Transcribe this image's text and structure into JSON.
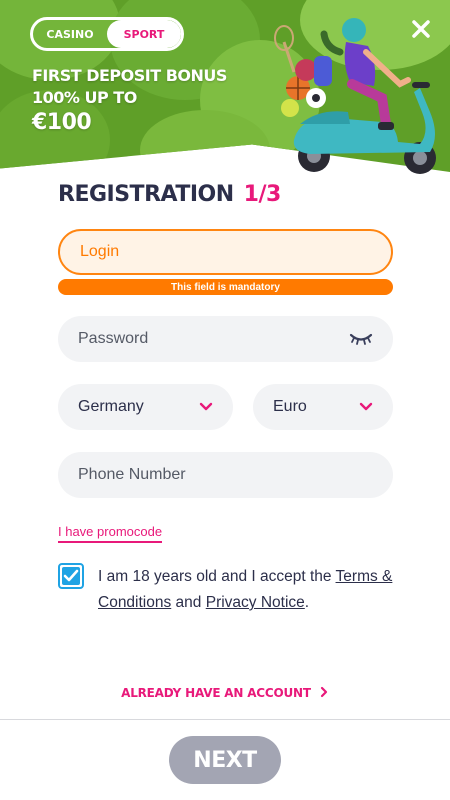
{
  "banner": {
    "tabs": [
      {
        "label": "CASINO",
        "active": false
      },
      {
        "label": "SPORT",
        "active": true
      }
    ],
    "bonus_line1": "FIRST DEPOSIT BONUS",
    "bonus_line2": "100% UP TO",
    "bonus_line3": "€100",
    "close_icon": "close-icon"
  },
  "form": {
    "title": "REGISTRATION",
    "step": "1/3",
    "login": {
      "placeholder": "Login",
      "error": "This field is mandatory"
    },
    "password": {
      "placeholder": "Password",
      "icon": "eye-closed-icon"
    },
    "country": {
      "value": "Germany",
      "icon": "chevron-down-icon"
    },
    "currency": {
      "value": "Euro",
      "icon": "chevron-down-icon"
    },
    "phone": {
      "placeholder": "Phone Number"
    },
    "promocode_label": "I have promocode",
    "consent": {
      "checked": true,
      "text_before": "I am 18 years old and I accept the ",
      "terms_link": "Terms & Conditions",
      "text_middle": " and ",
      "privacy_link": "Privacy Notice",
      "text_after": "."
    },
    "already_account": "ALREADY HAVE AN ACCOUNT",
    "next_label": "NEXT"
  },
  "colors": {
    "accent": "#e8197a",
    "error": "#ff7a00",
    "checkbox": "#1fa3e4",
    "banner_green": "#5f9f28",
    "button_disabled": "#a3a5b3"
  }
}
